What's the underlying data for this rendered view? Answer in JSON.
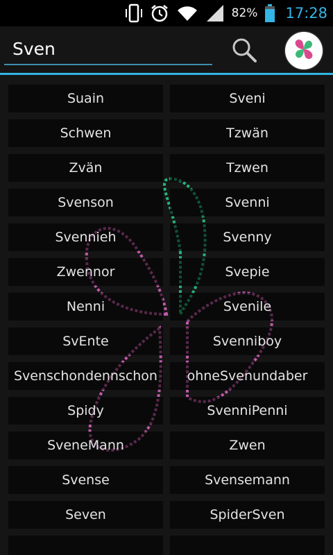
{
  "status_bar": {
    "battery_percent": "82%",
    "time": "17:28",
    "icons": [
      "vibrate-icon",
      "alarm-clock-icon",
      "wifi-icon",
      "signal-icon",
      "battery-icon"
    ],
    "time_color": "#33b5e5"
  },
  "search": {
    "value": "Sven",
    "icon": "magnifier-icon"
  },
  "app": {
    "logo_icon": "clover-heart-icon"
  },
  "colors": {
    "accent": "#33b5e5",
    "background": "#151515"
  },
  "names": [
    "Suain",
    "Sveni",
    "Schwen",
    "Tzwän",
    "Zvän",
    "Tzwen",
    "Svenson",
    "Svenni",
    "Svennieh",
    "Svenny",
    "Zwennor",
    "Svepie",
    "Nenni",
    "Svenile",
    "SvEnte",
    "Svenniboy",
    "Svenschondennschon",
    "ohneSvenundaber",
    "Spidy",
    "SvenniPenni",
    "SveneMann",
    "Zwen",
    "Svense",
    "Svensemann",
    "Seven",
    "SpiderSven",
    "",
    ""
  ]
}
